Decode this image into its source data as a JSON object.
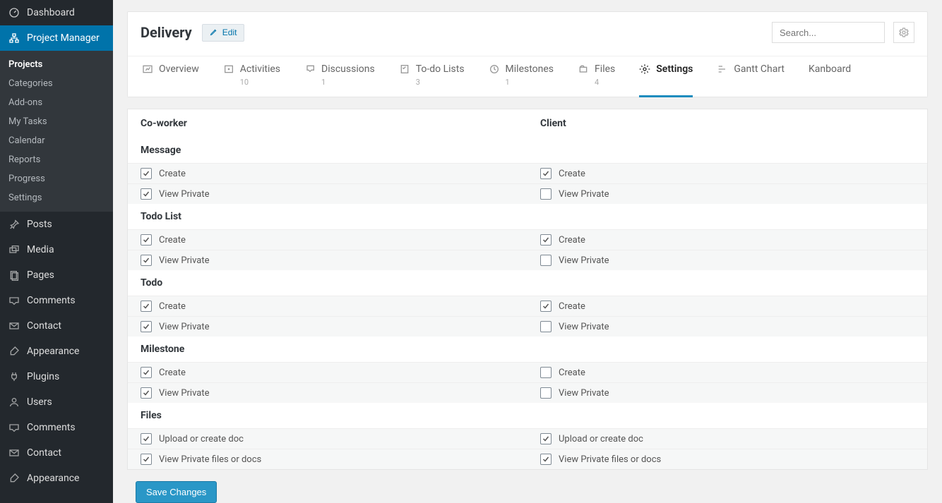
{
  "sidebar": {
    "top": [
      {
        "icon": "dashboard",
        "label": "Dashboard"
      },
      {
        "icon": "sitemap",
        "label": "Project Manager",
        "active": true
      }
    ],
    "pm_sub": [
      {
        "label": "Projects",
        "active": true
      },
      {
        "label": "Categories"
      },
      {
        "label": "Add-ons"
      },
      {
        "label": "My Tasks"
      },
      {
        "label": "Calendar"
      },
      {
        "label": "Reports"
      },
      {
        "label": "Progress"
      },
      {
        "label": "Settings"
      }
    ],
    "rest": [
      {
        "icon": "pin",
        "label": "Posts"
      },
      {
        "icon": "media",
        "label": "Media"
      },
      {
        "icon": "page",
        "label": "Pages"
      },
      {
        "icon": "comment",
        "label": "Comments"
      },
      {
        "icon": "mail",
        "label": "Contact"
      },
      {
        "icon": "brush",
        "label": "Appearance"
      },
      {
        "icon": "plug",
        "label": "Plugins"
      },
      {
        "icon": "user",
        "label": "Users"
      },
      {
        "icon": "comment",
        "label": "Comments"
      },
      {
        "icon": "mail",
        "label": "Contact"
      },
      {
        "icon": "brush",
        "label": "Appearance"
      }
    ]
  },
  "header": {
    "title": "Delivery",
    "edit_label": "Edit",
    "search_placeholder": "Search..."
  },
  "tabs": [
    {
      "icon": "overview",
      "label": "Overview",
      "count": ""
    },
    {
      "icon": "activities",
      "label": "Activities",
      "count": "10"
    },
    {
      "icon": "discussion",
      "label": "Discussions",
      "count": "1"
    },
    {
      "icon": "todo",
      "label": "To-do Lists",
      "count": "3"
    },
    {
      "icon": "milestone",
      "label": "Milestones",
      "count": "1"
    },
    {
      "icon": "files",
      "label": "Files",
      "count": "4"
    },
    {
      "icon": "gear",
      "label": "Settings",
      "count": "",
      "active": true
    },
    {
      "icon": "gantt",
      "label": "Gantt Chart",
      "count": ""
    },
    {
      "icon": "",
      "label": "Kanboard",
      "count": ""
    }
  ],
  "columns": {
    "left": "Co-worker",
    "right": "Client"
  },
  "categories": [
    {
      "name": "Message",
      "rows": [
        {
          "label": "Create",
          "left": true,
          "right": true
        },
        {
          "label": "View Private",
          "left": true,
          "right": false
        }
      ]
    },
    {
      "name": "Todo List",
      "rows": [
        {
          "label": "Create",
          "left": true,
          "right": true
        },
        {
          "label": "View Private",
          "left": true,
          "right": false
        }
      ]
    },
    {
      "name": "Todo",
      "rows": [
        {
          "label": "Create",
          "left": true,
          "right": true
        },
        {
          "label": "View Private",
          "left": true,
          "right": false
        }
      ]
    },
    {
      "name": "Milestone",
      "rows": [
        {
          "label": "Create",
          "left": true,
          "right": false
        },
        {
          "label": "View Private",
          "left": true,
          "right": false
        }
      ]
    },
    {
      "name": "Files",
      "rows": [
        {
          "label": "Upload or create doc",
          "left": true,
          "right": true
        },
        {
          "label": "View Private files or docs",
          "left": true,
          "right": true
        }
      ]
    }
  ],
  "save_label": "Save Changes"
}
